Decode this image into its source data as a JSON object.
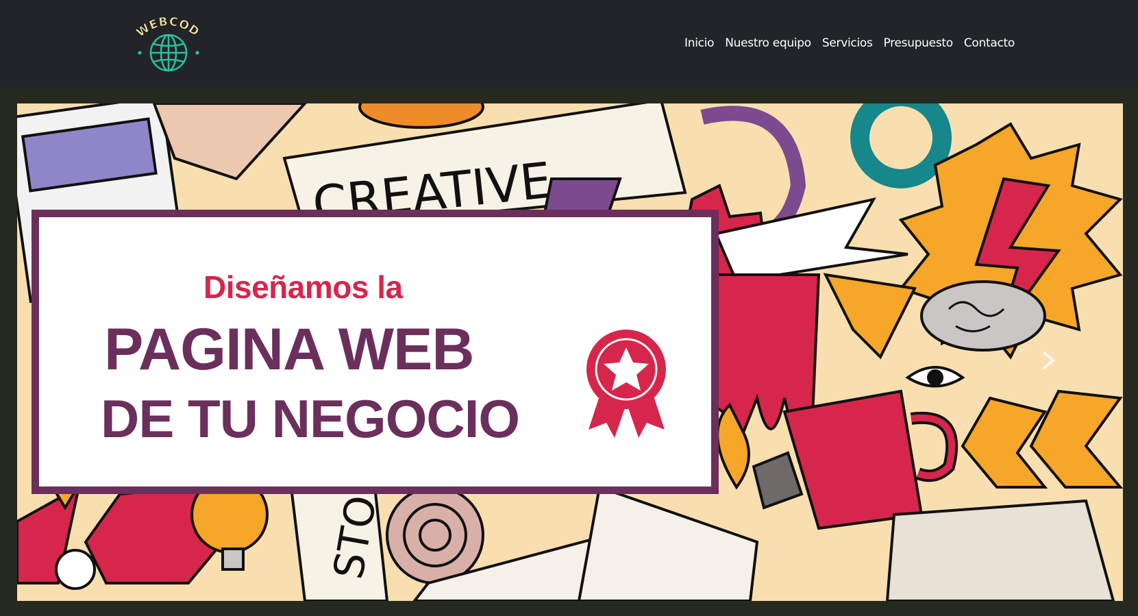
{
  "brand": {
    "logo_text": "WEBCODE",
    "logo_color": "#f3e2a0",
    "globe_color": "#2bbf9a"
  },
  "nav": {
    "items": [
      {
        "label": "Inicio"
      },
      {
        "label": "Nuestro equipo"
      },
      {
        "label": "Servicios"
      },
      {
        "label": "Presupuesto"
      },
      {
        "label": "Contacto"
      }
    ]
  },
  "hero": {
    "ribbon_word": "CREATIVE",
    "ribbon_word_2": "STOR",
    "headline_small": "Diseñamos la",
    "headline_big": "PAGINA WEB",
    "headline_sub": "DE TU NEGOCIO",
    "accent_color": "#d7264b",
    "primary_color": "#6b2f5c",
    "background_color": "#f9dfb0"
  },
  "colors": {
    "navbar": "#212529",
    "page_background": "#25291f"
  }
}
